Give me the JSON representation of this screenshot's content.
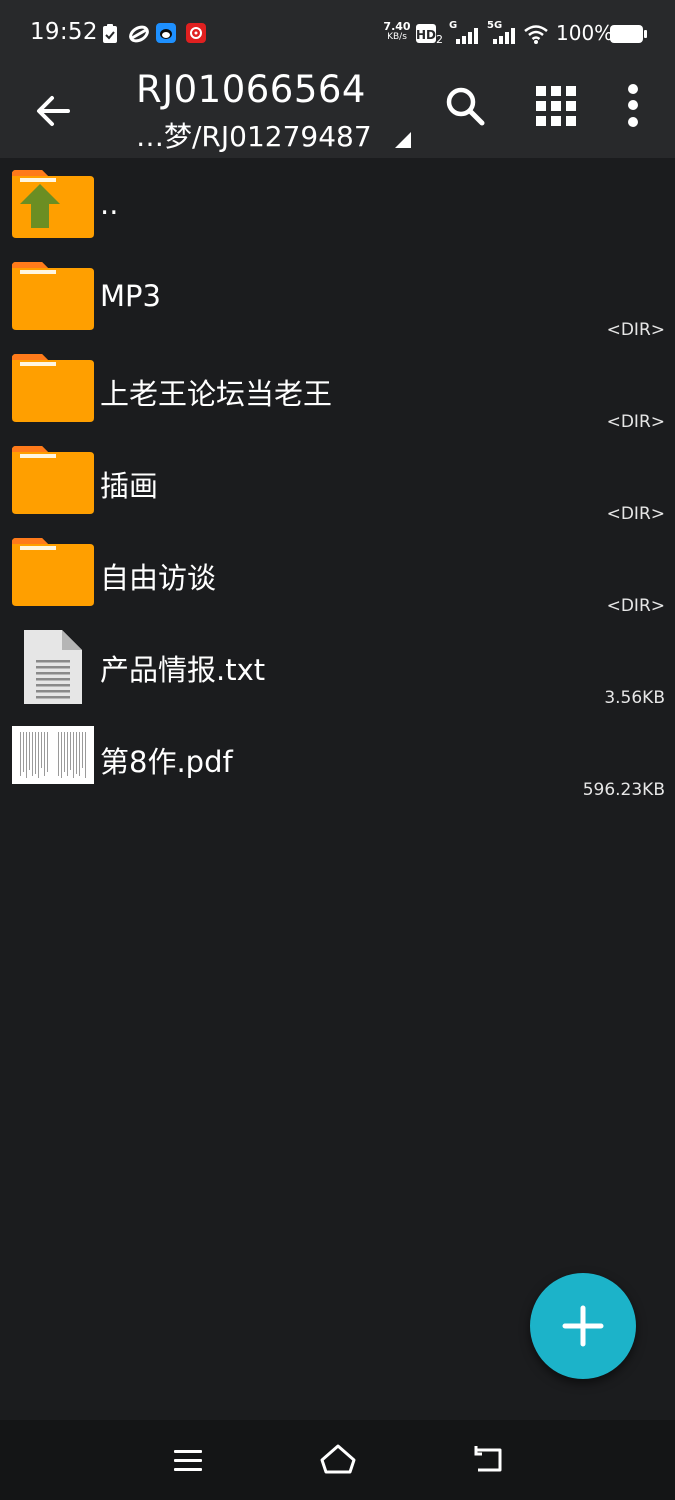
{
  "status_bar": {
    "time": "19:52",
    "net_speed_value": "7.40",
    "net_speed_unit": "KB/s",
    "hd_label": "HD",
    "hd_sub": "2",
    "sim1_label": "G",
    "sim2_label": "5G",
    "battery_pct": "100%",
    "notification_icons": [
      "check-clipboard-icon",
      "link-icon",
      "bird-app-icon",
      "red-app-icon"
    ]
  },
  "header": {
    "title": "RJ01066564",
    "subtitle": "…梦/RJ01279487",
    "actions": [
      "back-arrow-icon",
      "search-icon",
      "grid-view-icon",
      "more-vert-icon"
    ]
  },
  "files": [
    {
      "name": "..",
      "meta": "",
      "type": "parent"
    },
    {
      "name": "MP3",
      "meta": "<DIR>",
      "type": "folder"
    },
    {
      "name": "上老王论坛当老王",
      "meta": "<DIR>",
      "type": "folder"
    },
    {
      "name": "插画",
      "meta": "<DIR>",
      "type": "folder"
    },
    {
      "name": "自由访谈",
      "meta": "<DIR>",
      "type": "folder"
    },
    {
      "name": "产品情报.txt",
      "meta": "3.56KB",
      "type": "text"
    },
    {
      "name": "第8作.pdf",
      "meta": "596.23KB",
      "type": "pdf"
    }
  ],
  "colors": {
    "folder": "#ff9f00",
    "folder_tab": "#ff7a1a",
    "up_arrow": "#6b8e23",
    "fab": "#1cb3c9",
    "app_bar": "#28292b",
    "background": "#1b1c1e"
  },
  "nav_bar": [
    "menu-icon",
    "home-icon",
    "back-icon"
  ]
}
